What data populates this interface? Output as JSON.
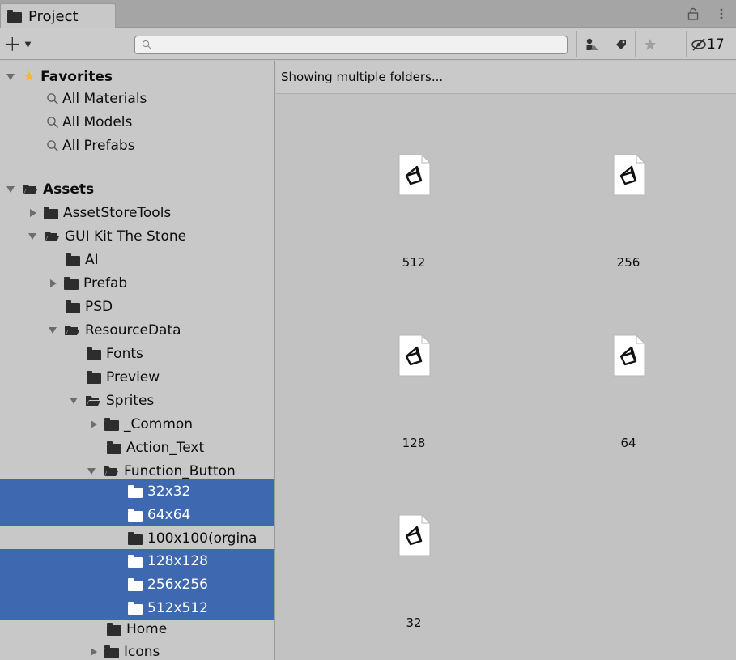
{
  "window": {
    "tab_label": "Project"
  },
  "toolbar": {
    "create_label": "+",
    "search": {
      "value": "",
      "placeholder": ""
    },
    "hidden_packages_count": "17"
  },
  "sidebar": {
    "favorites": {
      "label": "Favorites",
      "items": [
        "All Materials",
        "All Models",
        "All Prefabs"
      ]
    },
    "assets": {
      "label": "Assets",
      "tree": [
        "AssetStoreTools",
        "GUI Kit The Stone",
        "AI",
        "Prefab",
        "PSD",
        "ResourceData",
        "Fonts",
        "Preview",
        "Sprites",
        "_Common",
        "Action_Text",
        "Function_Button",
        "32x32",
        "64x64",
        "100x100(orgina",
        "128x128",
        "256x256",
        "512x512",
        "Home",
        "Icons"
      ]
    }
  },
  "main": {
    "header": "Showing multiple folders...",
    "assets": [
      "512",
      "256",
      "128",
      "64",
      "32"
    ]
  },
  "colors": {
    "selection": "#3e68b0",
    "panel_bg": "#c2c2c2",
    "favorites_star": "#f2b92a"
  }
}
